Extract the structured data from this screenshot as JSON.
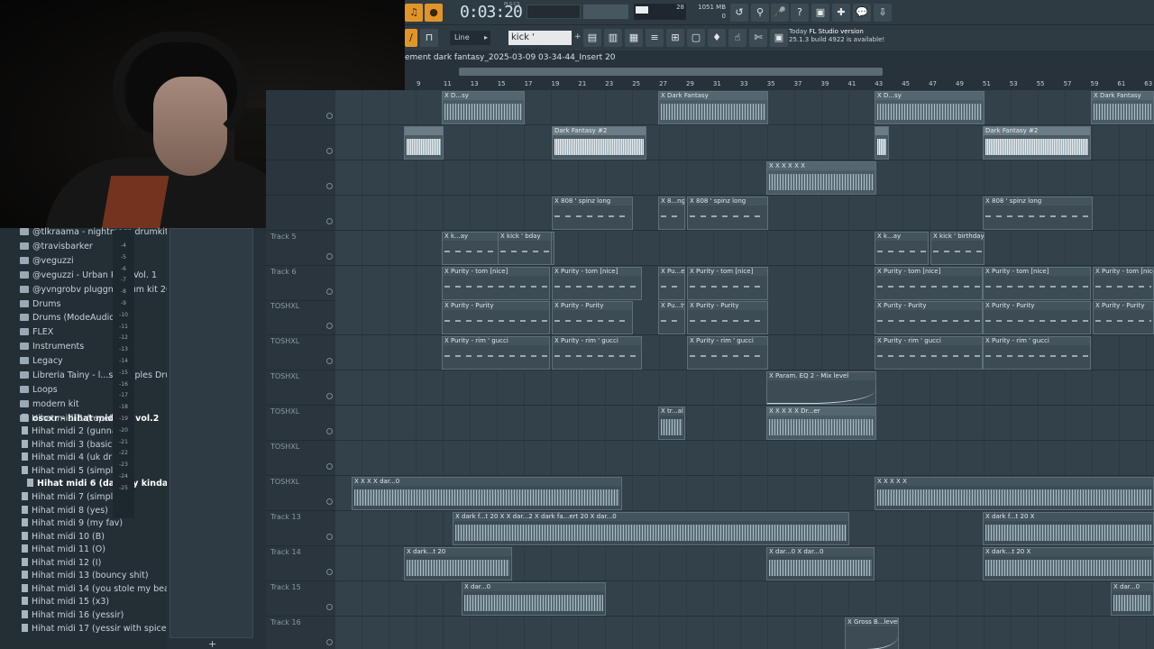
{
  "transport": {
    "time": "0:03:20",
    "time_unit": "M:S:CS",
    "tempo_hint": "28",
    "memory": "1051 MB",
    "cpu": "0"
  },
  "toolbar": {
    "snap_mode": "Line",
    "pattern_name": "kick ' birthday"
  },
  "news": {
    "prefix": "Today",
    "title": "FL Studio version",
    "line2": "25.1.3 build 4922 is available!"
  },
  "path": {
    "text": "ement   dark fantasy_2025-03-09 03-34-44_Insert 20"
  },
  "ruler": {
    "ticks": [
      "9",
      "11",
      "13",
      "15",
      "17",
      "19",
      "21",
      "23",
      "25",
      "27",
      "29",
      "31",
      "33",
      "35",
      "37",
      "39",
      "41",
      "43",
      "45",
      "47",
      "49",
      "51",
      "53",
      "55",
      "57",
      "59",
      "61",
      "63"
    ]
  },
  "browser": {
    "items": [
      {
        "label": "@tlkraama - nightmare drumkit",
        "kind": "folder",
        "bold": false
      },
      {
        "label": "@travisbarker",
        "kind": "folder",
        "bold": false
      },
      {
        "label": "@veguzzi",
        "kind": "folder",
        "bold": false
      },
      {
        "label": "@veguzzi - Urban Pack Vol. 1",
        "kind": "folder",
        "bold": false
      },
      {
        "label": "@yvngrobv pluggnb drum kit 2021",
        "kind": "folder",
        "bold": false
      },
      {
        "label": "Drums",
        "kind": "folder",
        "bold": false
      },
      {
        "label": "Drums (ModeAudio)",
        "kind": "folder",
        "bold": false
      },
      {
        "label": "FLEX",
        "kind": "folder",
        "bold": false
      },
      {
        "label": "Instruments",
        "kind": "folder",
        "bold": false
      },
      {
        "label": "Legacy",
        "kind": "folder",
        "bold": false
      },
      {
        "label": "Libreria Tainy - l...s Samples Drum Kit",
        "kind": "folder",
        "bold": false
      },
      {
        "label": "Loops",
        "kind": "folder",
        "bold": false
      },
      {
        "label": "modern kit",
        "kind": "folder",
        "bold": false
      },
      {
        "label": "oscxr - hihat midi kit vol.2",
        "kind": "folder",
        "bold": true
      },
      {
        "label": "Hihat midi 1 (repetitive)",
        "kind": "file",
        "bold": false
      },
      {
        "label": "Hihat midi 2 (gunna)",
        "kind": "file",
        "bold": false
      },
      {
        "label": "Hihat midi 3 (basic af)",
        "kind": "file",
        "bold": false
      },
      {
        "label": "Hihat midi 4 (uk drill)",
        "kind": "file",
        "bold": false
      },
      {
        "label": "Hihat midi 5 (simple 1)",
        "kind": "file",
        "bold": false
      },
      {
        "label": "Hihat midi 6 (dababy kinda)",
        "kind": "file",
        "bold": true
      },
      {
        "label": "Hihat midi 7 (simple 2)",
        "kind": "file",
        "bold": false
      },
      {
        "label": "Hihat midi 8 (yes)",
        "kind": "file",
        "bold": false
      },
      {
        "label": "Hihat midi 9 (my fav)",
        "kind": "file",
        "bold": false
      },
      {
        "label": "Hihat midi 10 (B)",
        "kind": "file",
        "bold": false
      },
      {
        "label": "Hihat midi 11 (O)",
        "kind": "file",
        "bold": false
      },
      {
        "label": "Hihat midi 12 (I)",
        "kind": "file",
        "bold": false
      },
      {
        "label": "Hihat midi 13 (bouncy shit)",
        "kind": "file",
        "bold": false
      },
      {
        "label": "Hihat midi 14 (you stole my beans)",
        "kind": "file",
        "bold": false
      },
      {
        "label": "Hihat midi 15 (x3)",
        "kind": "file",
        "bold": false
      },
      {
        "label": "Hihat midi 16 (yessir)",
        "kind": "file",
        "bold": false
      },
      {
        "label": "Hihat midi 17 (yessir with spice)",
        "kind": "file",
        "bold": false
      }
    ],
    "scroll_numbers": [
      "-4",
      "-5",
      "-6",
      "-7",
      "-8",
      "-9",
      "-10",
      "-11",
      "-12",
      "-13",
      "-14",
      "-15",
      "-16",
      "-17",
      "-18",
      "-19",
      "-20",
      "-21",
      "-22",
      "-23",
      "-24",
      "-25"
    ]
  },
  "tracks": [
    "",
    "",
    "",
    "",
    "Track 5",
    "Track 6",
    "TOSHXL",
    "TOSHXL",
    "TOSHXL",
    "TOSHXL",
    "TOSHXL",
    "TOSHXL",
    "Track 13",
    "Track 14",
    "Track 15",
    "Track 16"
  ],
  "clips": [
    {
      "row": 0,
      "style": "normal",
      "label": "X D...sy",
      "wave": "audio"
    },
    {
      "row": 0,
      "style": "normal",
      "label": "X Dark Fantasy",
      "wave": "audio"
    },
    {
      "row": 0,
      "style": "normal",
      "label": "X D...sy",
      "wave": "audio"
    },
    {
      "row": 0,
      "style": "normal",
      "label": "X Dark Fantasy",
      "wave": "audio"
    },
    {
      "row": 1,
      "style": "white",
      "label": "",
      "wave": "audio"
    },
    {
      "row": 1,
      "style": "white",
      "label": "Dark Fantasy #2",
      "wave": "audio"
    },
    {
      "row": 1,
      "style": "white",
      "label": "",
      "wave": "audio"
    },
    {
      "row": 1,
      "style": "white",
      "label": "Dark Fantasy #2",
      "wave": "audio"
    },
    {
      "row": 2,
      "style": "normal",
      "label": "X X X X X X",
      "wave": "audio"
    },
    {
      "row": 3,
      "style": "dark",
      "label": "X 808 ' spinz long",
      "wave": "notes"
    },
    {
      "row": 3,
      "style": "dark",
      "label": "X 8...ng",
      "wave": "notes"
    },
    {
      "row": 3,
      "style": "dark",
      "label": "X 808 ' spinz long",
      "wave": "notes"
    },
    {
      "row": 3,
      "style": "dark",
      "label": "X 808 ' spinz long",
      "wave": "notes"
    },
    {
      "row": 4,
      "style": "dark",
      "label": "X k...ay",
      "wave": "notes"
    },
    {
      "row": 4,
      "style": "dark",
      "label": "X kick ' bday",
      "wave": "notes"
    },
    {
      "row": 4,
      "style": "dark",
      "label": "X k...ay",
      "wave": "notes"
    },
    {
      "row": 4,
      "style": "dark",
      "label": "X kick ' birthday",
      "wave": "notes"
    },
    {
      "row": 5,
      "style": "dark",
      "label": "X Purity - tom [nice]",
      "wave": "notes"
    },
    {
      "row": 5,
      "style": "dark",
      "label": "X Purity - tom [nice]",
      "wave": "notes"
    },
    {
      "row": 5,
      "style": "dark",
      "label": "X Pu...e]",
      "wave": "notes"
    },
    {
      "row": 5,
      "style": "dark",
      "label": "X Purity - tom [nice]",
      "wave": "notes"
    },
    {
      "row": 5,
      "style": "dark",
      "label": "X Purity - tom [nice]",
      "wave": "notes"
    },
    {
      "row": 5,
      "style": "dark",
      "label": "X Purity - tom [nice]",
      "wave": "notes"
    },
    {
      "row": 5,
      "style": "dark",
      "label": "X Purity - tom [nice]",
      "wave": "notes"
    },
    {
      "row": 6,
      "style": "dark",
      "label": "X Purity - Purity",
      "wave": "notes"
    },
    {
      "row": 6,
      "style": "dark",
      "label": "X Purity - Purity",
      "wave": "notes"
    },
    {
      "row": 6,
      "style": "dark",
      "label": "X Pu...ty",
      "wave": "notes"
    },
    {
      "row": 6,
      "style": "dark",
      "label": "X Purity - Purity",
      "wave": "notes"
    },
    {
      "row": 6,
      "style": "dark",
      "label": "X Purity - Purity",
      "wave": "notes"
    },
    {
      "row": 6,
      "style": "dark",
      "label": "X Purity - Purity",
      "wave": "notes"
    },
    {
      "row": 6,
      "style": "dark",
      "label": "X Purity - Purity",
      "wave": "notes"
    },
    {
      "row": 7,
      "style": "dark",
      "label": "X Purity - rim ' gucci",
      "wave": "notes"
    },
    {
      "row": 7,
      "style": "dark",
      "label": "X Purity - rim ' gucci",
      "wave": "notes"
    },
    {
      "row": 7,
      "style": "dark",
      "label": "X Purity - rim ' gucci",
      "wave": "notes"
    },
    {
      "row": 7,
      "style": "dark",
      "label": "X Purity - rim ' gucci",
      "wave": "notes"
    },
    {
      "row": 7,
      "style": "dark",
      "label": "X Purity - rim ' gucci",
      "wave": "notes"
    },
    {
      "row": 8,
      "style": "dark",
      "label": "X Param. EQ 2 - Mix level",
      "wave": "auto"
    },
    {
      "row": 9,
      "style": "dark",
      "label": "X tr...al",
      "wave": "audio"
    },
    {
      "row": 9,
      "style": "normal",
      "label": "X X X X X Dr...er",
      "wave": "audio"
    },
    {
      "row": 11,
      "style": "dark",
      "label": "X X X X dar...0",
      "wave": "audio"
    },
    {
      "row": 11,
      "style": "dark",
      "label": "X X X X X",
      "wave": "audio"
    },
    {
      "row": 12,
      "style": "dark",
      "label": "X dark f...t 20 X X dar...2 X dark fa...ert 20 X dar...0",
      "wave": "audio"
    },
    {
      "row": 12,
      "style": "dark",
      "label": "X dark f...t 20 X",
      "wave": "audio"
    },
    {
      "row": 13,
      "style": "dark",
      "label": "X dark...t 20",
      "wave": "audio"
    },
    {
      "row": 13,
      "style": "dark",
      "label": "X dar...0 X dar...0",
      "wave": "audio"
    },
    {
      "row": 13,
      "style": "dark",
      "label": "X dark...t 20 X",
      "wave": "audio"
    },
    {
      "row": 14,
      "style": "dark",
      "label": "X dar...0",
      "wave": "audio"
    },
    {
      "row": 14,
      "style": "dark",
      "label": "X dar...0",
      "wave": "audio"
    },
    {
      "row": 15,
      "style": "dark",
      "label": "X Gross B...level",
      "wave": "auto"
    }
  ],
  "colors": {
    "accent": "#e0952c",
    "background": "#33414a",
    "toolbar": "#2f3b43"
  }
}
